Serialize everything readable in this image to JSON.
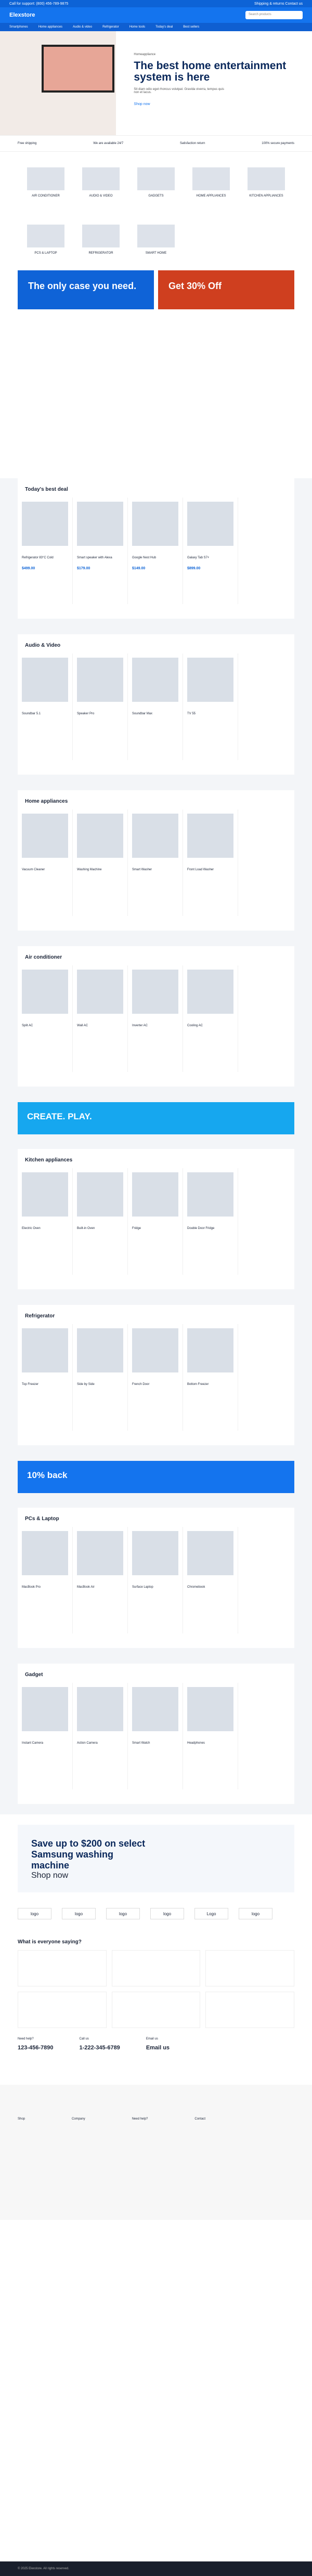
{
  "topbar": {
    "left": "Call for support: (800) 456-789-9875",
    "right": "Shipping & returns Contact us"
  },
  "header": {
    "brand": "Elexstore",
    "search": "Search products"
  },
  "nav": [
    "Smartphones",
    "Home appliances",
    "Audio & video",
    "Refrigerator",
    "Home tools",
    "Today's deal",
    "Best sellers"
  ],
  "hero": {
    "tag": "Homeappliance",
    "title": "The best home entertainment system is here",
    "text": "Sit diam odio eget rhoncus volutpat. Gravida viverra, tempus quis non et lacus.",
    "link": "Shop now"
  },
  "features": [
    "Free shipping",
    "We are available 24/7",
    "Satisfaction return",
    "100% secure payments"
  ],
  "categories": [
    "AIR CONDITIONER",
    "AUDIO & VIDEO",
    "GADGETS",
    "HOME APPLIANCES",
    "KITCHEN APPLIANCES",
    "PCS & LAPTOP",
    "REFRIGERATOR",
    "SMART HOME"
  ],
  "promos": [
    "The only case you need.",
    "Get 30% Off"
  ],
  "sections": {
    "deals": {
      "title": "Today's best deal",
      "products": [
        "Refrigerator 83°C Cold",
        "Smart speaker with Alexa",
        "Google Nest Hub",
        "Galaxy Tab S7+"
      ],
      "prices": [
        "$499.00",
        "$179.00",
        "$149.00",
        "$899.00"
      ]
    },
    "audio": {
      "title": "Audio & Video",
      "products": [
        "Soundbar 5.1",
        "Speaker Pro",
        "Soundbar Max",
        "TV 55"
      ]
    },
    "home": {
      "title": "Home appliances",
      "products": [
        "Vacuum Cleaner",
        "Washing Machine",
        "Smart Washer",
        "Front Load Washer"
      ]
    },
    "air": {
      "title": "Air conditioner",
      "products": [
        "Split AC",
        "Wall AC",
        "Inverter AC",
        "Cooling AC"
      ]
    },
    "kitchen": {
      "title": "Kitchen appliances",
      "products": [
        "Electric Oven",
        "Built-in Oven",
        "Fridge",
        "Double Door Fridge"
      ]
    },
    "fridge": {
      "title": "Refrigerator",
      "products": [
        "Top Freezer",
        "Side by Side",
        "French Door",
        "Bottom Freezer"
      ]
    },
    "pc": {
      "title": "PCs & Laptop",
      "products": [
        "MacBook Pro",
        "MacBook Air",
        "Surface Laptop",
        "Chromebook"
      ]
    },
    "gadget": {
      "title": "Gadget",
      "products": [
        "Instant Camera",
        "Action Camera",
        "Smart Watch",
        "Headphones"
      ]
    }
  },
  "promo2": [
    "CREATE. PLAY.",
    "10% back"
  ],
  "save": {
    "title": "Save up to $200 on select Samsung washing machine",
    "link": "Shop now"
  },
  "brands": [
    "logo",
    "logo",
    "logo",
    "logo",
    "Logo",
    "logo"
  ],
  "reviews": {
    "title": "What is everyone saying?"
  },
  "support": [
    {
      "label": "Need help?",
      "phone": "123-456-7890"
    },
    {
      "label": "Call us",
      "phone": "1-222-345-6789"
    },
    {
      "label": "Email us",
      "phone": "Email us"
    }
  ],
  "footer": [
    "Shop",
    "Company",
    "Need help?",
    "Contact"
  ],
  "copyright": "© 2025 Elexstore. All rights reserved."
}
